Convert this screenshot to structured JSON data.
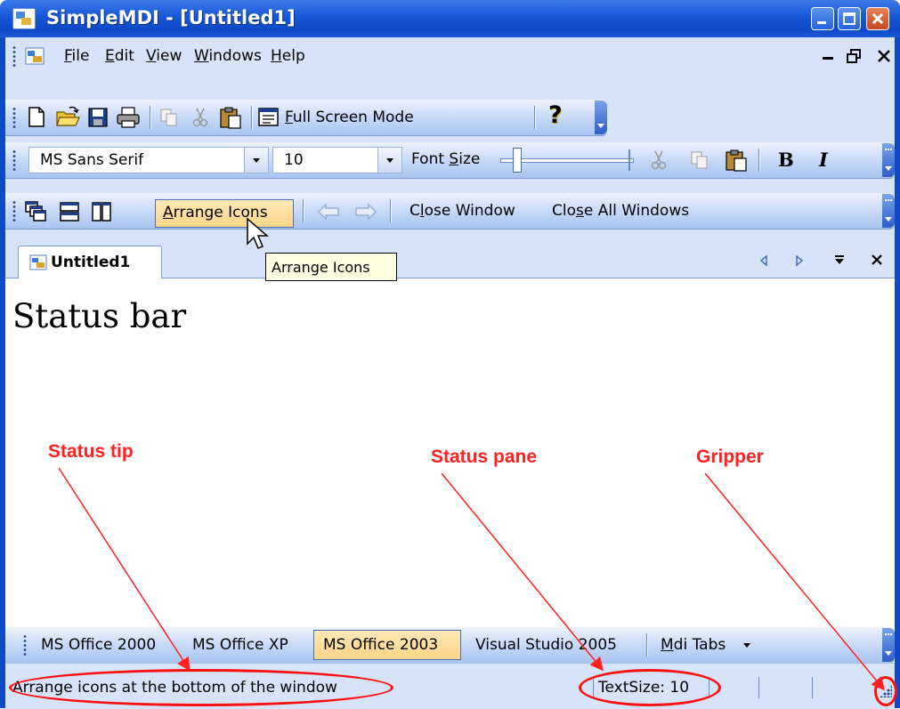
{
  "window": {
    "title": "SimpleMDI - [Untitled1]"
  },
  "menu": {
    "items": [
      {
        "mnemonic": "F",
        "rest": "ile"
      },
      {
        "mnemonic": "E",
        "rest": "dit"
      },
      {
        "mnemonic": "V",
        "rest": "iew"
      },
      {
        "mnemonic": "W",
        "rest": "indows"
      },
      {
        "mnemonic": "H",
        "rest": "elp"
      }
    ],
    "mdi_minimize": "–",
    "mdi_restore": "🗗",
    "mdi_close": "×"
  },
  "toolbar_main": {
    "full_screen_mnemonic": "F",
    "full_screen_rest": "ull Screen Mode",
    "help_glyph": "?"
  },
  "toolbar_format": {
    "font_name": "MS Sans Serif",
    "font_size": "10",
    "font_size_label_pre": "Font ",
    "font_size_label_mnemonic": "S",
    "font_size_label_post": "ize",
    "slider_value": 0.1,
    "bold_glyph": "B",
    "italic_glyph": "I"
  },
  "toolbar_window": {
    "arrange_pre": "",
    "arrange_mnemonic": "A",
    "arrange_post": "rrange Icons",
    "close_window_pre": "C",
    "close_window_mnemonic": "l",
    "close_window_post": "ose Window",
    "close_all_pre": "Clo",
    "close_all_mnemonic": "s",
    "close_all_post": "e All Windows"
  },
  "tooltip": {
    "text": "Arrange Icons"
  },
  "tabs": {
    "document_tab": "Untitled1"
  },
  "document": {
    "heading": "Status bar"
  },
  "annotations": {
    "status_tip": "Status tip",
    "status_pane": "Status pane",
    "gripper": "Gripper"
  },
  "bottom_toolbar": {
    "themes": [
      "MS Office 2000",
      "MS Office XP",
      "MS Office 2003",
      "Visual Studio 2005"
    ],
    "selected_theme": "MS Office 2003",
    "mdi_tabs_pre": "",
    "mdi_tabs_mnemonic": "M",
    "mdi_tabs_post": "di Tabs"
  },
  "statusbar": {
    "tip": "Arrange icons at the bottom of the window",
    "text_size": "TextSize: 10"
  },
  "colors": {
    "annotation": "#ff2020",
    "title_bar": "#1756d6",
    "highlight": "#ffd58a"
  }
}
